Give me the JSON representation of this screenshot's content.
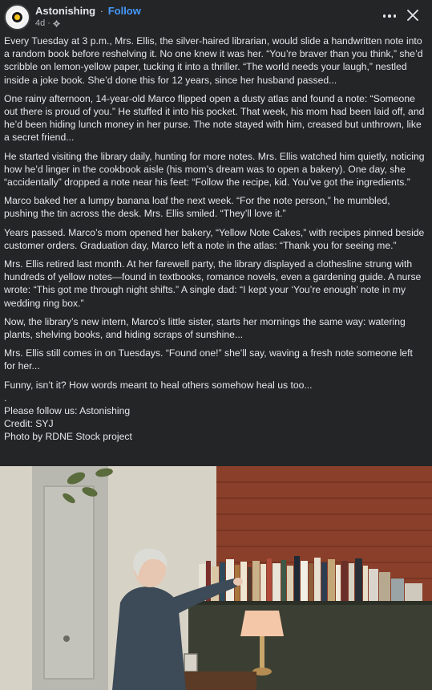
{
  "header": {
    "page_name": "Astonishing",
    "separator": "·",
    "follow_label": "Follow",
    "timestamp": "4d",
    "meta_separator": "·",
    "avatar_icon": "astonishing-logo",
    "privacy_icon": "gear-icon",
    "more_icon": "more-horizontal-icon",
    "close_icon": "close-icon"
  },
  "post": {
    "paragraphs": [
      "Every Tuesday at 3 p.m., Mrs. Ellis, the silver-haired librarian, would slide a handwritten note into a random book before reshelving it. No one knew it was her. “You’re braver than you think,” she’d scribble on lemon-yellow paper, tucking it into a thriller. “The world needs your laugh,” nestled inside a joke book. She’d done this for 12 years, since her husband passed...",
      "One rainy afternoon, 14-year-old Marco flipped open a dusty atlas and found a note: “Someone out there is proud of you.” He stuffed it into his pocket. That week, his mom had been laid off, and he’d been hiding lunch money in her purse. The note stayed with him, creased but unthrown, like a secret friend...",
      "He started visiting the library daily, hunting for more notes. Mrs. Ellis watched him quietly, noticing how he’d linger in the cookbook aisle (his mom’s dream was to open a bakery). One day, she “accidentally” dropped a note near his feet: “Follow the recipe, kid. You’ve got the ingredients.”",
      "Marco baked her a lumpy banana loaf the next week. “For the note person,” he mumbled, pushing the tin across the desk. Mrs. Ellis smiled. “They’ll love it.”",
      "Years passed. Marco’s mom opened her bakery, “Yellow Note Cakes,” with recipes pinned beside customer orders. Graduation day, Marco left a note in the atlas: “Thank you for seeing me.”",
      "Mrs. Ellis retired last month. At her farewell party, the library displayed a clothesline strung with hundreds of yellow notes—found in textbooks, romance novels, even a gardening guide. A nurse wrote: “This got me through night shifts.” A single dad: “I kept your ‘You’re enough’ note in my wedding ring box.”",
      "Now, the library’s new intern, Marco’s little sister, starts her mornings the same way: watering plants, shelving books, and hiding scraps of sunshine...",
      "Mrs. Ellis still comes in on Tuesdays. “Found one!” she’ll say, waving a fresh note someone left for her...",
      "Funny, isn’t it? How words meant to heal others somehow heal us too..."
    ],
    "dot_line": ".",
    "footer_lines": [
      "Please follow us: Astonishing",
      "Credit: SYJ",
      "Photo by RDNE Stock project"
    ]
  },
  "photo": {
    "colors": {
      "wall": "#d7d2c6",
      "door": "#b9b8b0",
      "brick": "#8a3f2a",
      "cabinet": "#3b3f33",
      "cardigan": "#3d4a57",
      "hair": "#dcdcd6",
      "lamp_shade": "#f4c7a8"
    }
  }
}
